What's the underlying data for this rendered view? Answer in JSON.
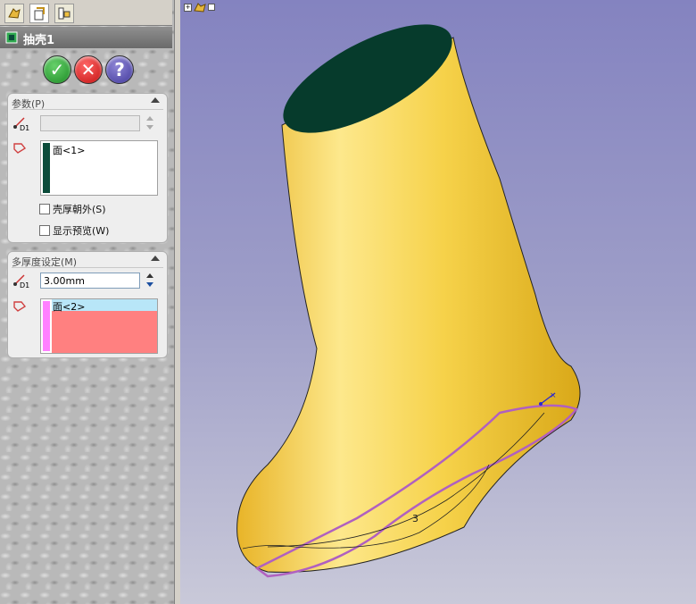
{
  "feature": {
    "title": "抽壳1",
    "actions": {
      "ok": "✓",
      "cancel": "✕",
      "help": "?"
    }
  },
  "tabs": [
    {
      "icon": "feature-manager-icon"
    },
    {
      "icon": "property-manager-icon"
    },
    {
      "icon": "configuration-manager-icon"
    }
  ],
  "parameters": {
    "header": "参数(P)",
    "thickness_value": "",
    "thickness_label": "D1",
    "faces": [
      "面<1>"
    ],
    "face_color": "#0b4b3a",
    "options": [
      {
        "label": "壳厚朝外(S)",
        "checked": false
      },
      {
        "label": "显示预览(W)",
        "checked": false
      }
    ]
  },
  "multi_thickness": {
    "header": "多厚度设定(M)",
    "thickness_value": "3.00mm",
    "thickness_label": "D1",
    "faces": [
      "面<2>"
    ],
    "face_color": "#ff80ff",
    "selected_row_color": "#b8e6f8",
    "list_fill_color": "#ff8080"
  },
  "viewport": {
    "tree_icon": "part-tree-icon",
    "dimension_label": "3",
    "boot_color": "#f6d24a",
    "opening_color": "#063b2c",
    "edge_color": "#b060c0"
  }
}
